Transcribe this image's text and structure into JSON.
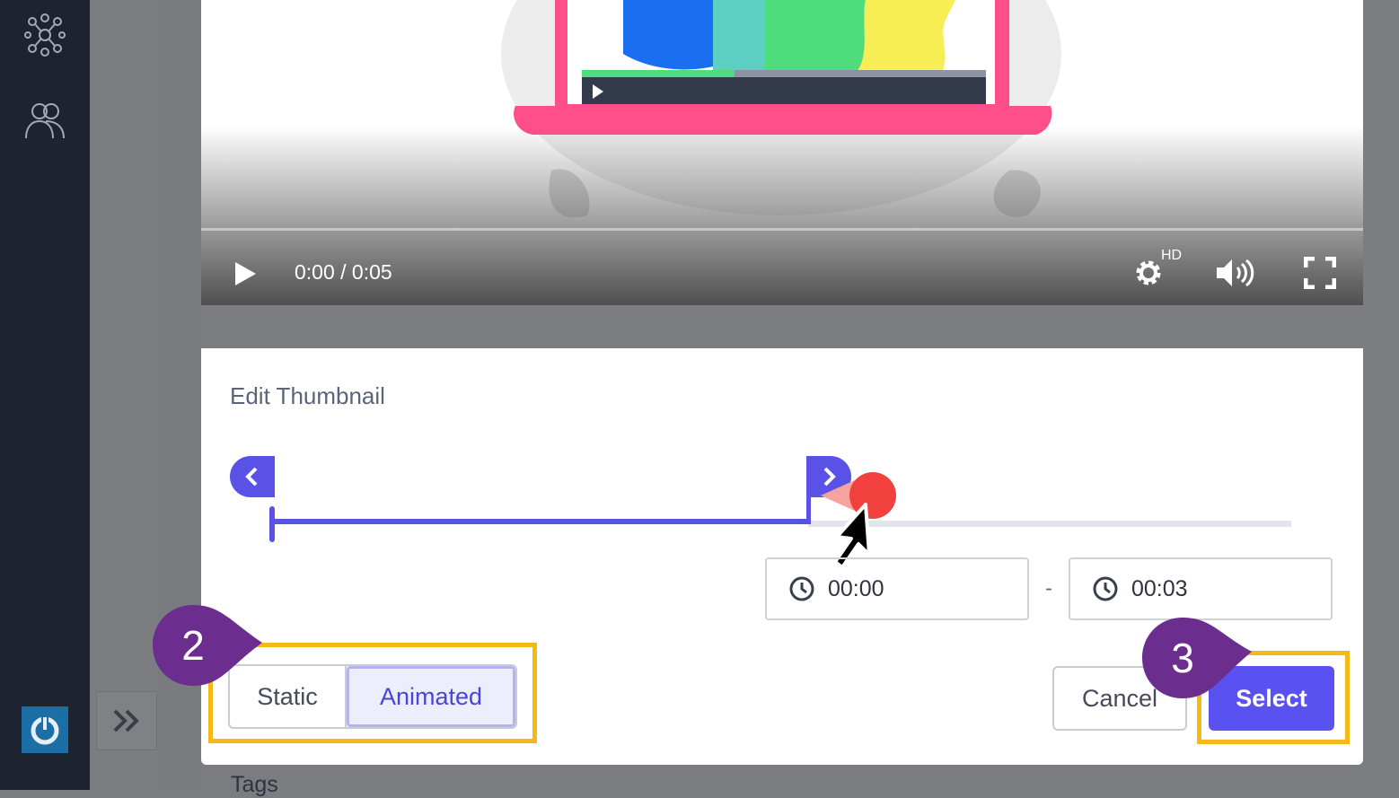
{
  "sidebar": {
    "icons": [
      "network-icon",
      "users-icon"
    ],
    "power_icon": "power-icon",
    "expand_icon": "double-chevron-right-icon"
  },
  "video": {
    "time_display": "0:00 / 0:05",
    "hd_badge": "HD",
    "progress": 0.0
  },
  "thumbnail_panel": {
    "title": "Edit Thumbnail",
    "start_time": "00:00",
    "end_time": "00:03",
    "separator": "-",
    "mode_options": [
      "Static",
      "Animated"
    ],
    "selected_mode": "Animated",
    "cancel_label": "Cancel",
    "select_label": "Select"
  },
  "next_section": {
    "label": "Tags"
  },
  "callouts": {
    "step_a": "2",
    "step_b": "3"
  },
  "colors": {
    "accent": "#5a52f0",
    "highlight": "#f5b917",
    "callout": "#6b2e8f",
    "sidebar": "#1e2330",
    "cursor_dot": "#f2403f"
  }
}
